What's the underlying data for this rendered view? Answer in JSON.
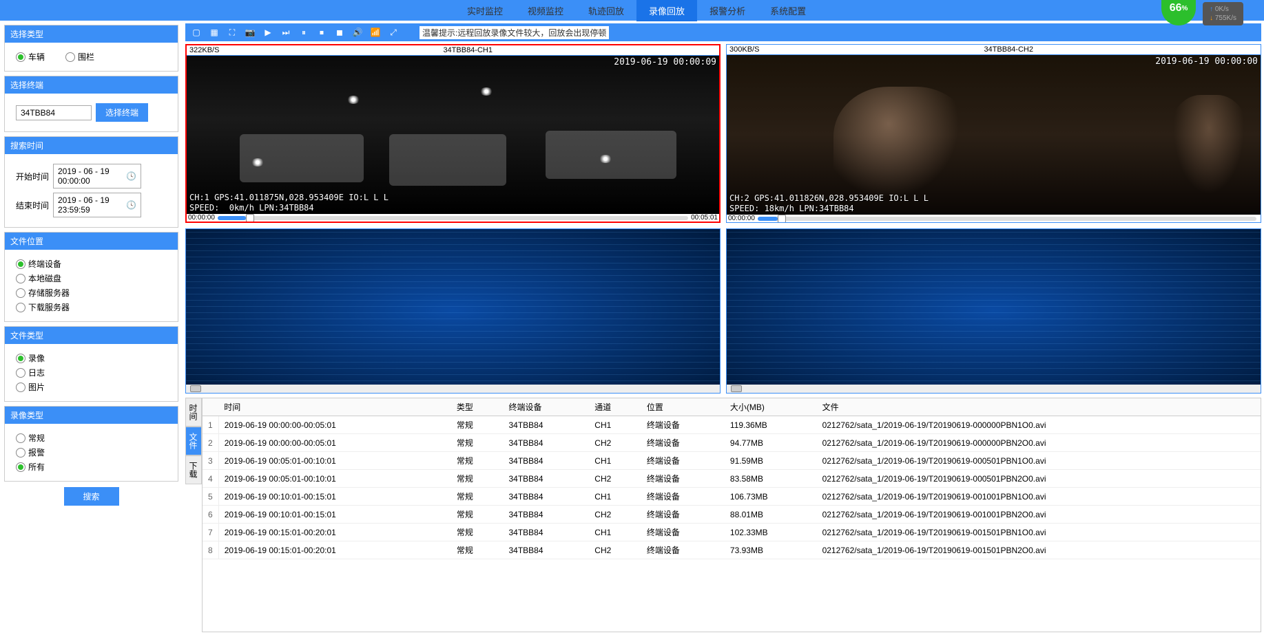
{
  "topnav": {
    "items": [
      "实时监控",
      "视频监控",
      "轨迹回放",
      "录像回放",
      "报警分析",
      "系统配置"
    ],
    "activeIndex": 3,
    "gauge": "66",
    "gaugeUnit": "%",
    "upLabel": "↑",
    "upSpeed": "0K/s",
    "downLabel": "↓",
    "downSpeed": "755K/s"
  },
  "sidebar": {
    "selectType": {
      "title": "选择类型",
      "opt1": "车辆",
      "opt2": "围栏"
    },
    "selectTerminal": {
      "title": "选择终端",
      "value": "34TBB84",
      "btn": "选择终端"
    },
    "searchTime": {
      "title": "搜索时间",
      "startLabel": "开始时间",
      "startValue": "2019 - 06 - 19 00:00:00",
      "endLabel": "结束时间",
      "endValue": "2019 - 06 - 19 23:59:59"
    },
    "fileLoc": {
      "title": "文件位置",
      "opts": [
        "终端设备",
        "本地磁盘",
        "存储服务器",
        "下载服务器"
      ],
      "selected": 0
    },
    "fileType": {
      "title": "文件类型",
      "opts": [
        "录像",
        "日志",
        "图片"
      ],
      "selected": 0
    },
    "recordType": {
      "title": "录像类型",
      "opts": [
        "常规",
        "报警",
        "所有"
      ],
      "selected": 2
    },
    "searchBtn": "搜索"
  },
  "toolbar": {
    "hint": "温馨提示:远程回放录像文件较大，回放会出现停顿"
  },
  "videos": [
    {
      "rate": "322KB/S",
      "title": "34TBB84-CH1",
      "timestamp": "2019-06-19 00:00:09",
      "overlay": "CH:1 GPS:41.011875N,028.953409E IO:L L L\nSPEED:  0km/h LPN:34TBB84",
      "timeStart": "00:00:00",
      "timeEnd": "00:05:01",
      "progress": 6
    },
    {
      "rate": "300KB/S",
      "title": "34TBB84-CH2",
      "timestamp": "2019-06-19 00:00:00",
      "overlay": "CH:2 GPS:41.011826N,028.953409E IO:L L L\nSPEED: 18km/h LPN:34TBB84",
      "timeStart": "00:00:00",
      "timeEnd": "",
      "progress": 4
    }
  ],
  "table": {
    "sideTabs": [
      "时间",
      "文件",
      "下载"
    ],
    "activeSideTab": 1,
    "headers": [
      "",
      "时间",
      "类型",
      "终端设备",
      "通道",
      "位置",
      "大小(MB)",
      "文件"
    ],
    "rows": [
      [
        "1",
        "2019-06-19 00:00:00-00:05:01",
        "常规",
        "34TBB84",
        "CH1",
        "终端设备",
        "119.36MB",
        "0212762/sata_1/2019-06-19/T20190619-000000PBN1O0.avi"
      ],
      [
        "2",
        "2019-06-19 00:00:00-00:05:01",
        "常规",
        "34TBB84",
        "CH2",
        "终端设备",
        "94.77MB",
        "0212762/sata_1/2019-06-19/T20190619-000000PBN2O0.avi"
      ],
      [
        "3",
        "2019-06-19 00:05:01-00:10:01",
        "常规",
        "34TBB84",
        "CH1",
        "终端设备",
        "91.59MB",
        "0212762/sata_1/2019-06-19/T20190619-000501PBN1O0.avi"
      ],
      [
        "4",
        "2019-06-19 00:05:01-00:10:01",
        "常规",
        "34TBB84",
        "CH2",
        "终端设备",
        "83.58MB",
        "0212762/sata_1/2019-06-19/T20190619-000501PBN2O0.avi"
      ],
      [
        "5",
        "2019-06-19 00:10:01-00:15:01",
        "常规",
        "34TBB84",
        "CH1",
        "终端设备",
        "106.73MB",
        "0212762/sata_1/2019-06-19/T20190619-001001PBN1O0.avi"
      ],
      [
        "6",
        "2019-06-19 00:10:01-00:15:01",
        "常规",
        "34TBB84",
        "CH2",
        "终端设备",
        "88.01MB",
        "0212762/sata_1/2019-06-19/T20190619-001001PBN2O0.avi"
      ],
      [
        "7",
        "2019-06-19 00:15:01-00:20:01",
        "常规",
        "34TBB84",
        "CH1",
        "终端设备",
        "102.33MB",
        "0212762/sata_1/2019-06-19/T20190619-001501PBN1O0.avi"
      ],
      [
        "8",
        "2019-06-19 00:15:01-00:20:01",
        "常规",
        "34TBB84",
        "CH2",
        "终端设备",
        "73.93MB",
        "0212762/sata_1/2019-06-19/T20190619-001501PBN2O0.avi"
      ]
    ]
  }
}
